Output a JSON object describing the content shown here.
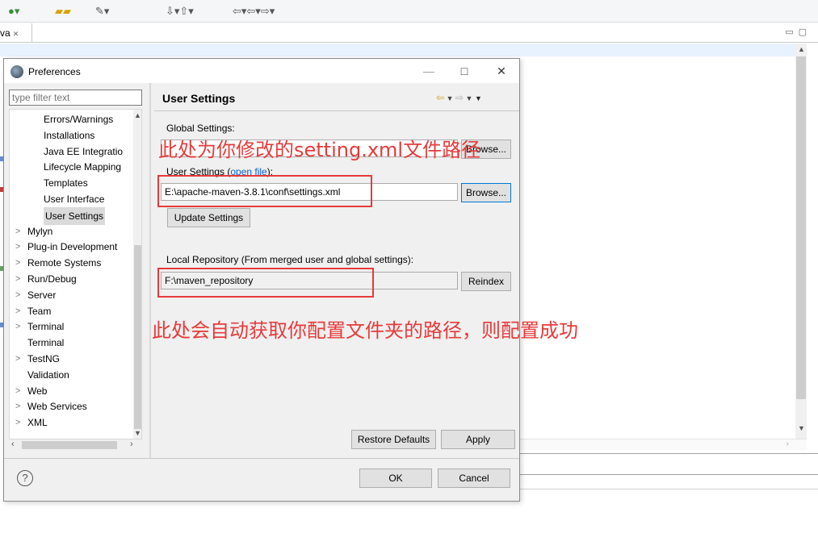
{
  "dialog": {
    "title": "Preferences",
    "min_glyph": "—",
    "max_glyph": "□",
    "close_glyph": "✕"
  },
  "editor": {
    "tab_label": "va",
    "tab_close": "✕"
  },
  "filter": {
    "placeholder": "type filter text"
  },
  "tree": {
    "items": [
      {
        "label": "Errors/Warnings",
        "arrow": ""
      },
      {
        "label": "Installations",
        "arrow": ""
      },
      {
        "label": "Java EE Integratio",
        "arrow": ""
      },
      {
        "label": "Lifecycle Mapping",
        "arrow": ""
      },
      {
        "label": "Templates",
        "arrow": ""
      },
      {
        "label": "User Interface",
        "arrow": ""
      },
      {
        "label": "User Settings",
        "arrow": ""
      },
      {
        "label": "Mylyn",
        "arrow": ">"
      },
      {
        "label": "Plug-in Development",
        "arrow": ">"
      },
      {
        "label": "Remote Systems",
        "arrow": ">"
      },
      {
        "label": "Run/Debug",
        "arrow": ">"
      },
      {
        "label": "Server",
        "arrow": ">"
      },
      {
        "label": "Team",
        "arrow": ">"
      },
      {
        "label": "Terminal",
        "arrow": ">"
      },
      {
        "label": "Terminal",
        "arrow": ""
      },
      {
        "label": "TestNG",
        "arrow": ">"
      },
      {
        "label": "Validation",
        "arrow": ""
      },
      {
        "label": "Web",
        "arrow": ">"
      },
      {
        "label": "Web Services",
        "arrow": ">"
      },
      {
        "label": "XML",
        "arrow": ">"
      }
    ],
    "selected": "User Settings"
  },
  "page": {
    "title": "User Settings",
    "global_label": "Global Settings:",
    "global_browse": "Browse...",
    "user_label": "User Settings (",
    "user_link": "open file",
    "user_label_end": "):",
    "user_value": "E:\\apache-maven-3.8.1\\conf\\settings.xml",
    "user_browse": "Browse...",
    "update_button": "Update Settings",
    "local_label": "Local Repository (From merged user and global settings):",
    "local_value": "F:\\maven_repository",
    "reindex_button": "Reindex",
    "restore_button": "Restore Defaults",
    "apply_button": "Apply"
  },
  "footer": {
    "help": "?",
    "ok_button": "OK",
    "cancel_button": "Cancel"
  },
  "annotations": {
    "top": "此处为你修改的setting.xml文件路径",
    "bottom": "此处会自动获取你配置文件夹的路径，则配置成功",
    "color": "#e83a3a"
  }
}
